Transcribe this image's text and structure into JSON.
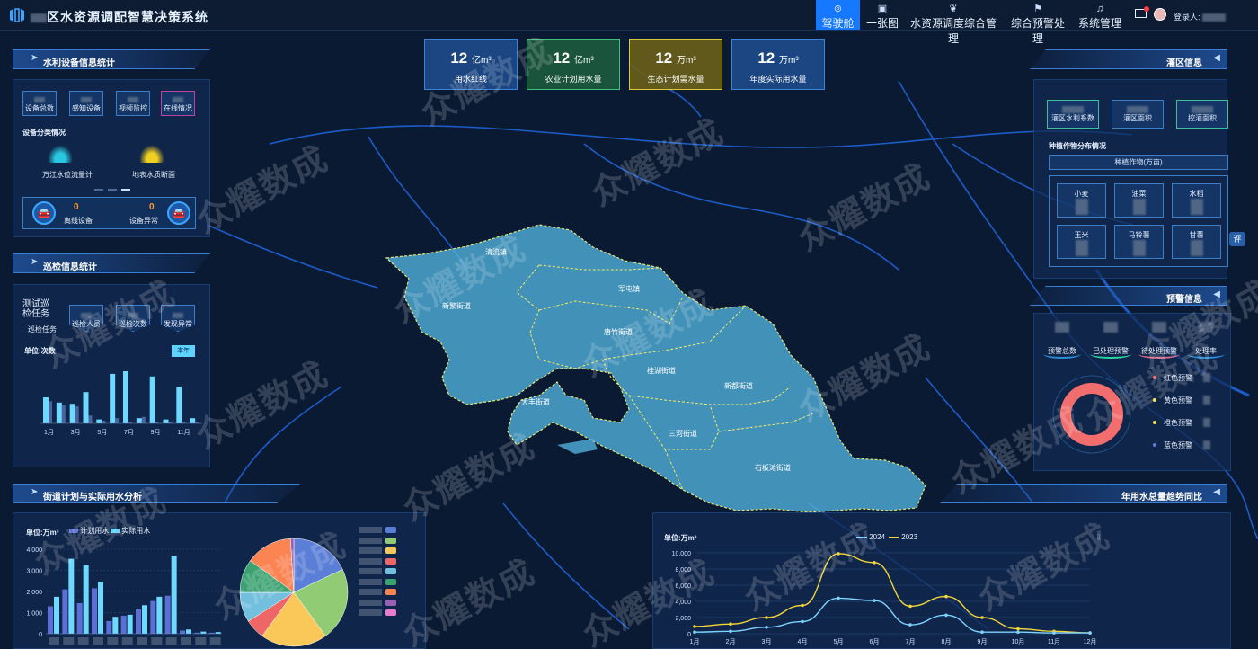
{
  "header": {
    "title_prefix": "",
    "title": "区水资源调配智慧决策系统",
    "nav": [
      {
        "label": "驾驶舱",
        "icon": "cockpit-icon",
        "active": true
      },
      {
        "label": "一张图",
        "icon": "map-image-icon",
        "active": false
      },
      {
        "label": "水资源调度综合管理",
        "icon": "leaf-icon",
        "active": false
      },
      {
        "label": "综合预警处理",
        "icon": "warning-flag-icon",
        "active": false
      },
      {
        "label": "系统管理",
        "icon": "bell-icon",
        "active": false
      }
    ],
    "user_label": "登录人:",
    "user_name": ""
  },
  "stat_cards": [
    {
      "value": "12",
      "unit": "亿m³",
      "label": "用水红线",
      "color": "#1f4f8f"
    },
    {
      "value": "12",
      "unit": "亿m³",
      "label": "农业计划用水量",
      "color": "#1c5b3e"
    },
    {
      "value": "12",
      "unit": "万m³",
      "label": "生态计划需水量",
      "color": "#6a6118"
    },
    {
      "value": "12",
      "unit": "万m³",
      "label": "年度实际用水量",
      "color": "#1f4f8f"
    }
  ],
  "equipment": {
    "title": "水利设备信息统计",
    "tiles": [
      "设备总数",
      "感知设备",
      "视频监控",
      "在线情况"
    ],
    "category_title": "设备分类情况",
    "categories": [
      "万江水位流量计",
      "地表水质断面"
    ],
    "offline_label": "离线设备",
    "offline_value": "0",
    "abnormal_label": "设备异常",
    "abnormal_value": "0"
  },
  "patrol": {
    "title": "巡检信息统计",
    "task_name": "测试巡检任务",
    "task_sub": "巡检任务",
    "tiles": [
      "巡检人员",
      "巡检次数",
      "发现异常"
    ],
    "unit": "单位:次数",
    "period_button": "本年",
    "months": [
      "1月",
      "3月",
      "5月",
      "7月",
      "9月",
      "11月"
    ],
    "values_a": [
      2,
      1.6,
      1.5,
      2.4,
      0.3,
      3.8,
      4,
      0.4,
      3.6,
      0.3,
      2.8,
      0.4
    ],
    "values_b": [
      1.7,
      1.4,
      1.3,
      0.6,
      0.2,
      0.4,
      0.1,
      0.5,
      0.1,
      0.1,
      0.1,
      0.1
    ]
  },
  "irrigation": {
    "title": "灌区信息",
    "tiles": [
      "灌区水利系数",
      "灌区面积",
      "控灌面积"
    ],
    "crops_title": "种植作物分布情况",
    "crops_header": "种植作物(万亩)",
    "crops": [
      "小麦",
      "油菜",
      "水稻",
      "玉米",
      "马铃薯",
      "甘薯"
    ]
  },
  "warning": {
    "title": "预警信息",
    "stats": [
      "预警总数",
      "已处理预警",
      "待处理预警",
      "处理率"
    ],
    "legend": [
      {
        "label": "红色预警",
        "color": "#ff5b5b"
      },
      {
        "label": "黄色预警",
        "color": "#f5e04b"
      },
      {
        "label": "橙色预警",
        "color": "#f5e04b"
      },
      {
        "label": "蓝色预警",
        "color": "#5a7fd6"
      }
    ],
    "donut_color": "#f26d6d"
  },
  "plan_vs_actual": {
    "title": "街道计划与实际用水分析",
    "unit": "单位:万m³",
    "legend": [
      "计划用水",
      "实际用水"
    ],
    "y_ticks": [
      "4,000",
      "3,000",
      "2,000",
      "1,000",
      "0"
    ],
    "plan": [
      1300,
      2100,
      1450,
      2150,
      600,
      850,
      1150,
      1550,
      1800,
      150,
      50,
      50
    ],
    "actual": [
      1750,
      3550,
      3250,
      2450,
      800,
      900,
      1350,
      1750,
      3700,
      200,
      100,
      80
    ],
    "pie": [
      {
        "value": 18,
        "color": "#5b7fd6"
      },
      {
        "value": 22,
        "color": "#91cc75"
      },
      {
        "value": 20,
        "color": "#fac858"
      },
      {
        "value": 6,
        "color": "#ee6666"
      },
      {
        "value": 9,
        "color": "#73c0de"
      },
      {
        "value": 10,
        "color": "#3ba272"
      },
      {
        "value": 14,
        "color": "#fc8452"
      },
      {
        "value": 1,
        "color": "#9a60b4"
      }
    ],
    "pie_legend_colors": [
      "#5b7fd6",
      "#91cc75",
      "#fac858",
      "#ee6666",
      "#73c0de",
      "#3ba272",
      "#fc8452",
      "#9a60b4",
      "#ea7ccc"
    ]
  },
  "annual_trend": {
    "title": "年用水总量趋势同比",
    "unit": "单位:万m³",
    "legend": [
      {
        "label": "2024",
        "color": "#7fd3ff"
      },
      {
        "label": "2023",
        "color": "#f2d63a"
      }
    ],
    "y_ticks": [
      "10,000",
      "8,000",
      "6,000",
      "4,000",
      "2,000",
      "0"
    ],
    "months": [
      "1月",
      "2月",
      "3月",
      "4月",
      "5月",
      "6月",
      "7月",
      "8月",
      "9月",
      "10月",
      "11月",
      "12月"
    ],
    "series_2024": [
      200,
      300,
      800,
      1500,
      4400,
      4100,
      1100,
      2300,
      200,
      200,
      100,
      100
    ],
    "series_2023": [
      900,
      1200,
      2000,
      3500,
      9900,
      8800,
      3400,
      4600,
      2000,
      600,
      300,
      100
    ]
  },
  "map_labels": [
    "清流镇",
    "军屯镇",
    "新繁街道",
    "唐竹街道",
    "桂湖街道",
    "新都街道",
    "大丰街道",
    "三河街道",
    "石板滩街道"
  ],
  "watermark": "众耀数成",
  "side_tab": "评"
}
